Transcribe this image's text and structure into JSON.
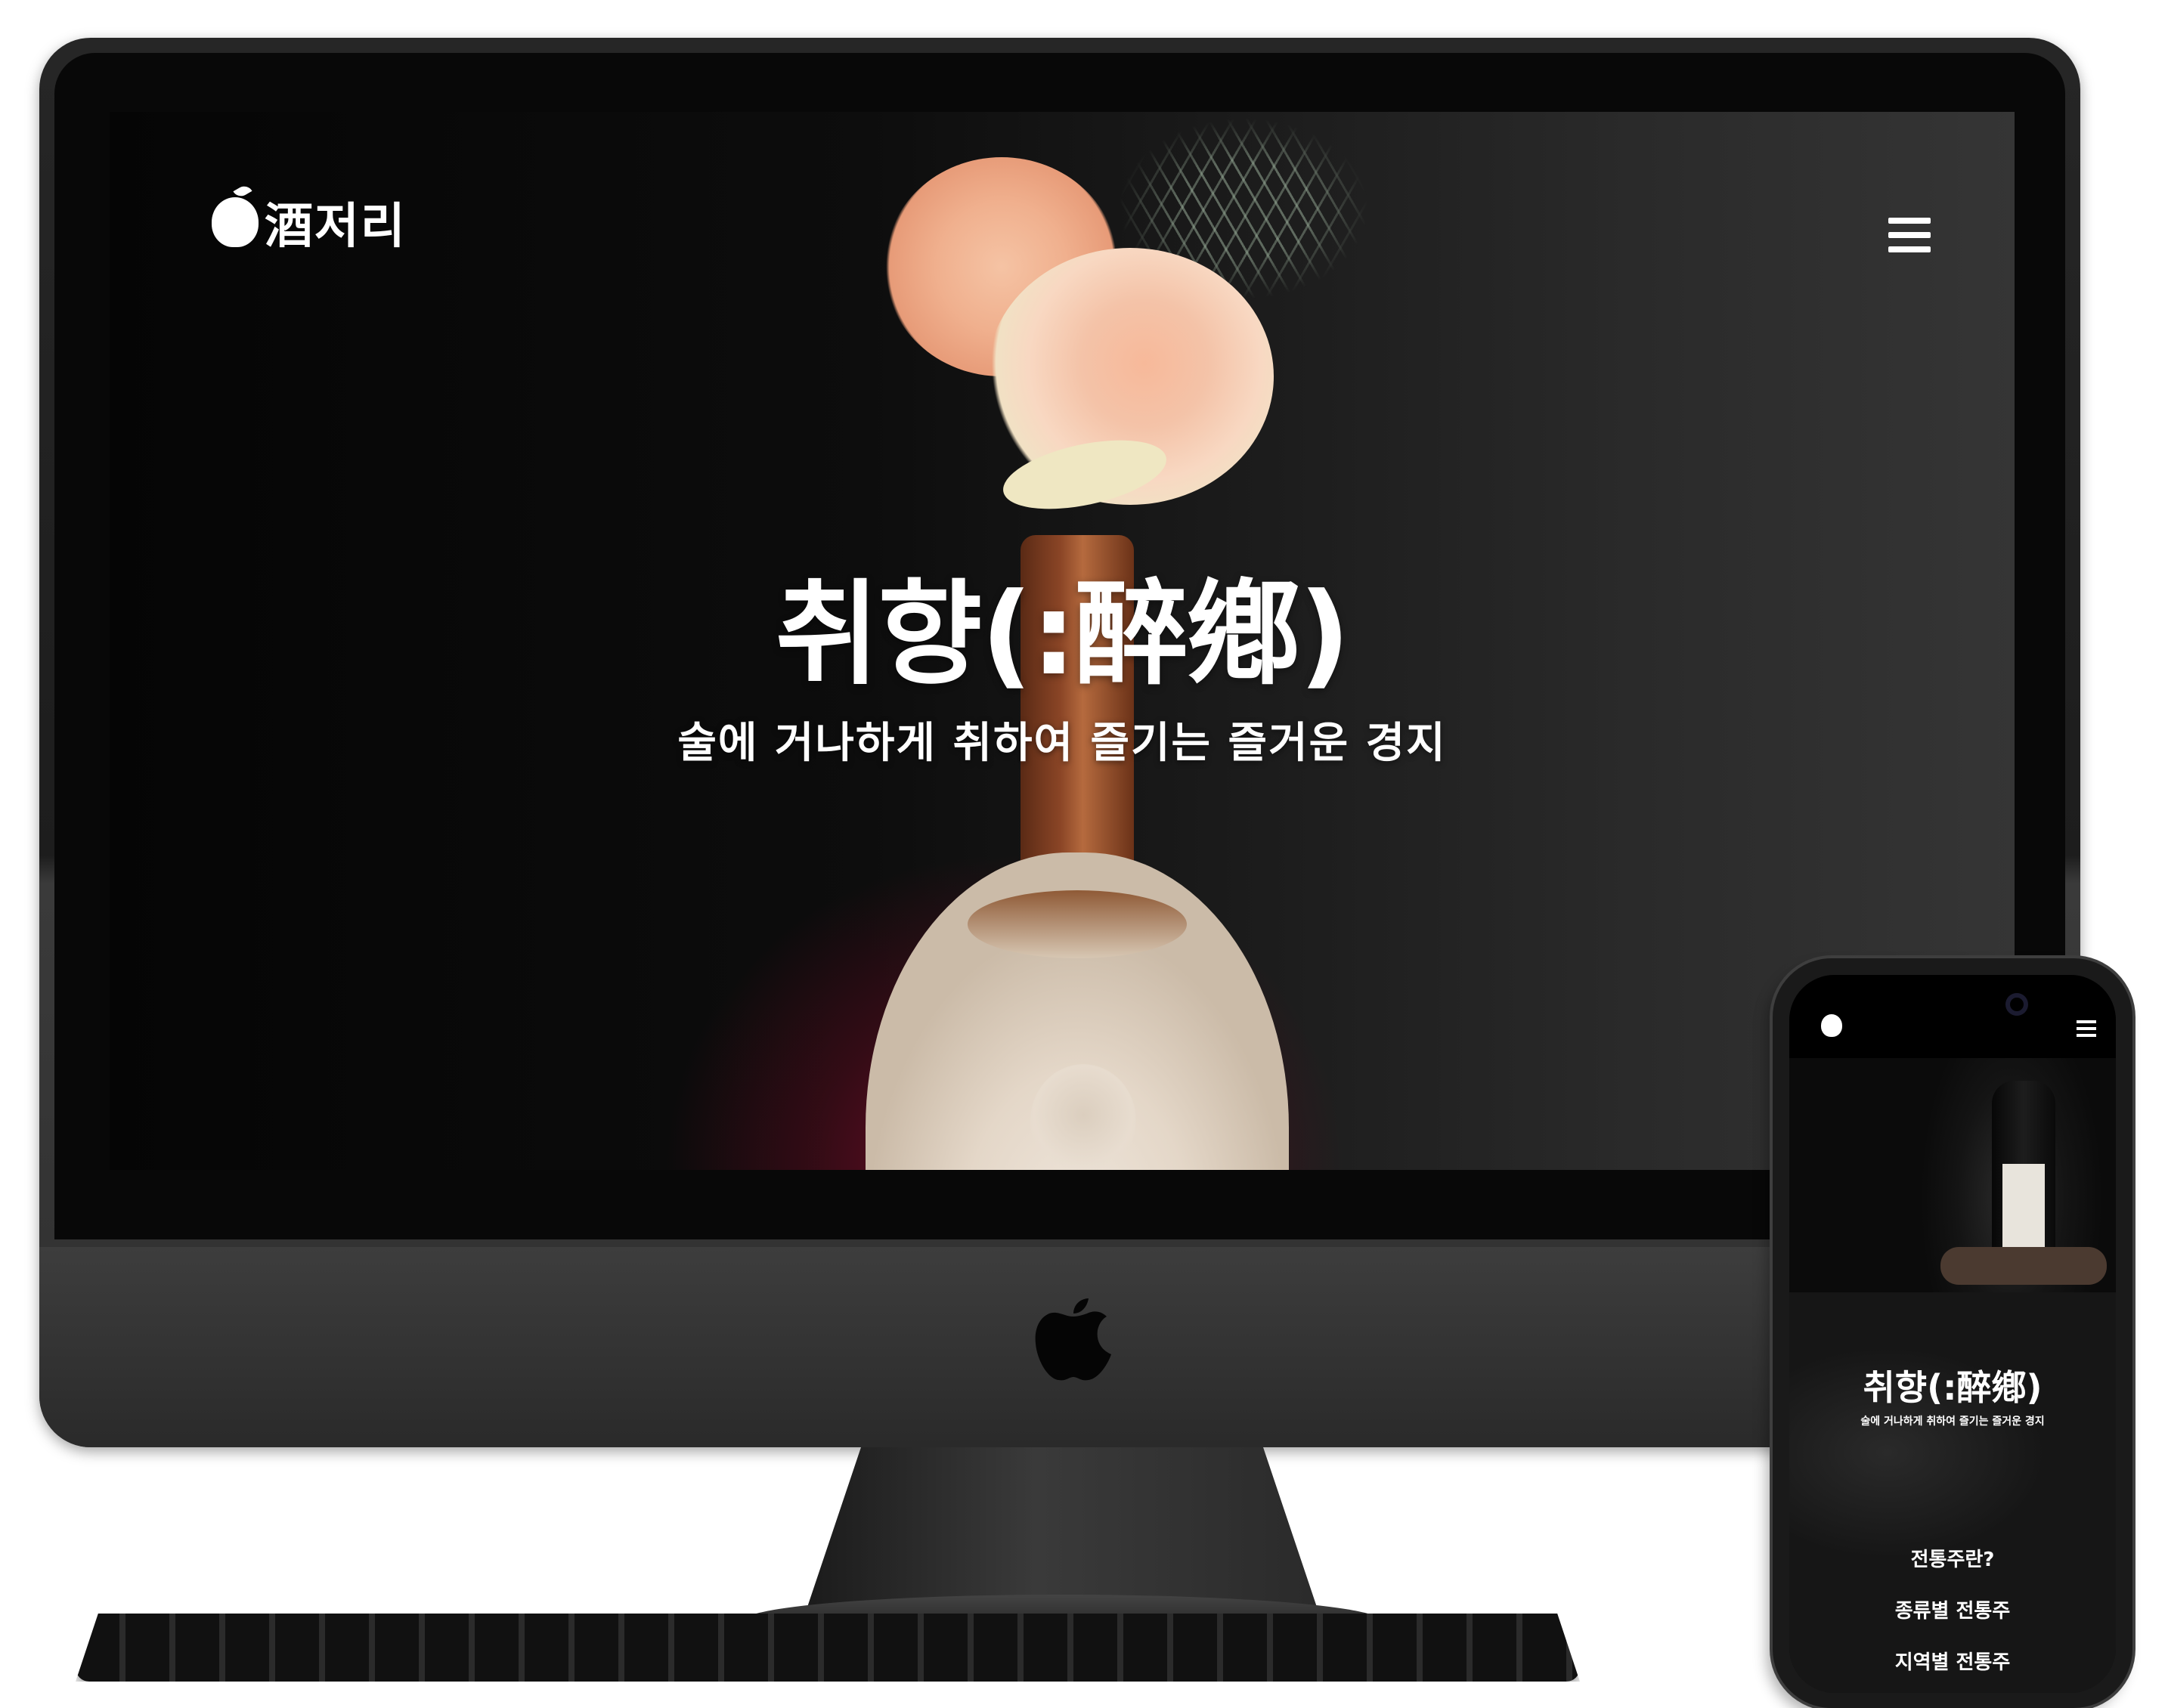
{
  "site": {
    "logo_text": "酒저리",
    "hero_title": "취향(:醉鄕)",
    "hero_subtitle": "술에 거나하게 취하여 즐기는 즐거운 경지"
  },
  "mobile": {
    "hero_title": "취향(:醉鄕)",
    "hero_subtitle": "술에 거나하게 취하여 즐기는 즐거운 경지",
    "menu": [
      "전통주란?",
      "종류별 전통주",
      "지역별 전통주"
    ]
  },
  "colors": {
    "hero_glow": "#8c1030",
    "text": "#ffffff"
  },
  "icons": [
    "apple-fruit-logo-icon",
    "hamburger-menu-icon",
    "apple-brand-logo-icon"
  ]
}
